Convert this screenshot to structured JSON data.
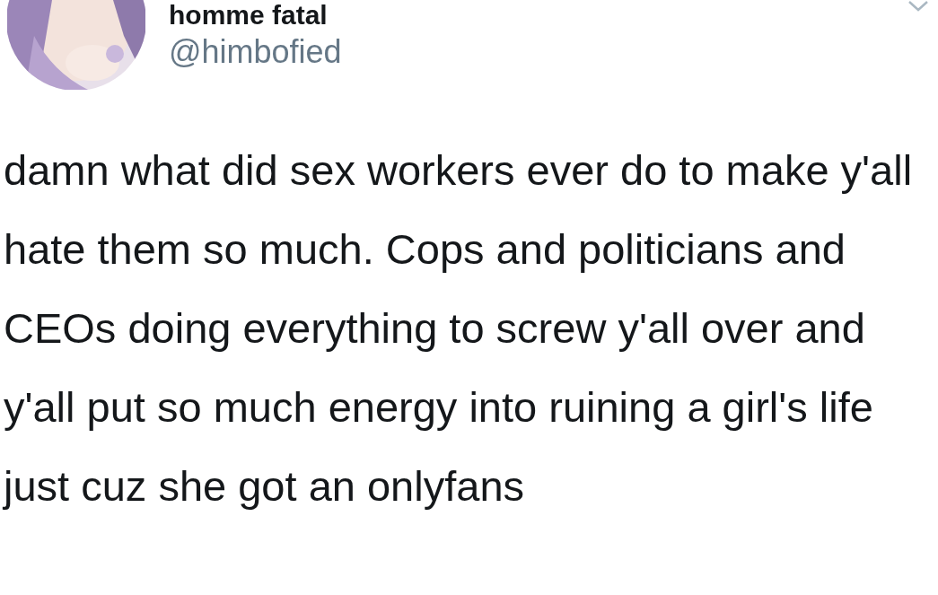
{
  "author": {
    "name": "homme fatal",
    "handle": "@himbofied"
  },
  "tweet": {
    "text": "damn what did sex workers ever do to make y'all hate them so much. Cops and politicians and CEOs doing everything to screw y'all over and y'all put so much energy into ruining a girl's life just cuz she got an onlyfans"
  }
}
